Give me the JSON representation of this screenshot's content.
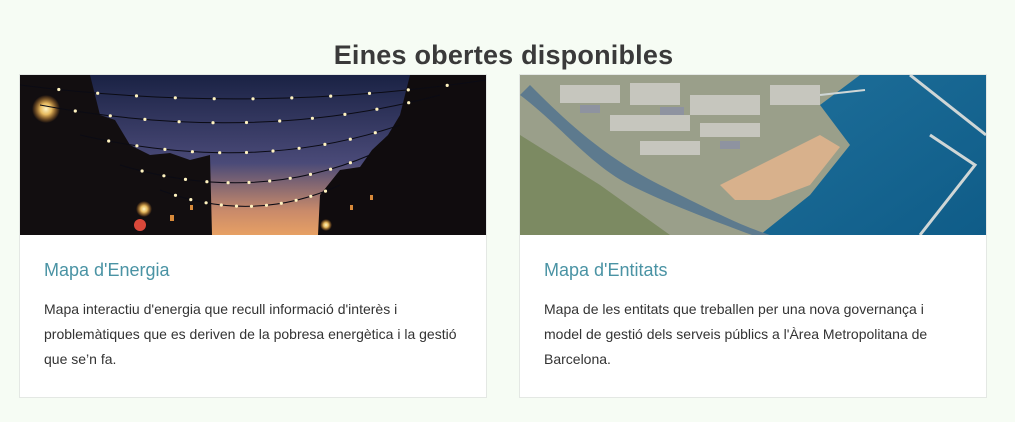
{
  "section": {
    "title": "Eines obertes disponibles"
  },
  "cards": [
    {
      "title": "Mapa d'Energia",
      "description": "Mapa interactiu d'energia que recull informació d'interès i problemàtiques que es deriven de la pobresa energètica i la gestió que se’n fa.",
      "image": "street-string-lights-at-dusk"
    },
    {
      "title": "Mapa d'Entitats",
      "description": "Mapa de les entitats que treballen per una nova governança i model de gestió dels serveis públics a l'Àrea Metropolitana de Barcelona.",
      "image": "aerial-view-port-and-river"
    }
  ],
  "colors": {
    "background": "#f6fcf4",
    "title_text": "#3a3a3a",
    "card_link": "#4a93a4",
    "body_text": "#333333"
  }
}
